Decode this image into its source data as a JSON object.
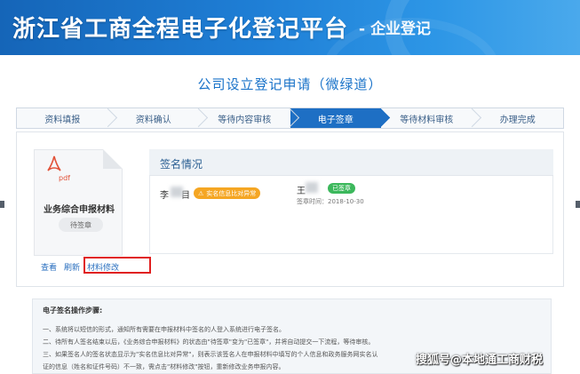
{
  "banner": {
    "title": "浙江省工商全程电子化登记平台",
    "subtitle_sep": "-",
    "subtitle": "企业登记"
  },
  "page_title": "公司设立登记申请（微绿道）",
  "steps": [
    {
      "label": "资料填报",
      "active": false
    },
    {
      "label": "资料确认",
      "active": false
    },
    {
      "label": "等待内容审核",
      "active": false
    },
    {
      "label": "电子签章",
      "active": true
    },
    {
      "label": "等待材料审核",
      "active": false
    },
    {
      "label": "办理完成",
      "active": false
    }
  ],
  "document": {
    "icon": "pdf-icon",
    "file_type": "pdf",
    "name": "业务综合申报材料",
    "status": "待签章",
    "links": {
      "view": "查看",
      "refresh": "刷新",
      "modify": "材料修改"
    }
  },
  "sign_panel": {
    "title": "签名情况",
    "signers": [
      {
        "name_visible_first": "李",
        "name_visible_last": "目",
        "badge": "实名信息比对异常",
        "badge_color": "#f5a623"
      },
      {
        "name_visible_first": "王",
        "name_visible_last": "",
        "badge": "已签章",
        "badge_color": "#3cb85c",
        "time": "签章时间：2018-10-30"
      }
    ]
  },
  "guide": {
    "title": "电子签名操作步骤:",
    "lines": [
      "一、系统将以短信的形式，通知所有需要在申报材料中签名的人登入系统进行电子签名。",
      "二、待所有人签名结束以后，《业务综合申报材料》的状态由\"待签章\"变为\"已签章\"，并将自动提交一下流程，等待审核。",
      "三、如果签名人的签名状态显示为\"实名信息比对异常\"，则表示该签名人在申报材料中填写的个人信息和政务服务网实名认",
      "证的信息（姓名和证件号码）不一致，需点击\"材料修改\"按钮，重新修改业务申报内容。"
    ]
  },
  "watermark": "搜狐号@本地通工商财税",
  "colors": {
    "accent": "#1e6fc4",
    "warn": "#f5a623",
    "ok": "#3cb85c",
    "highlight": "#e02020"
  }
}
